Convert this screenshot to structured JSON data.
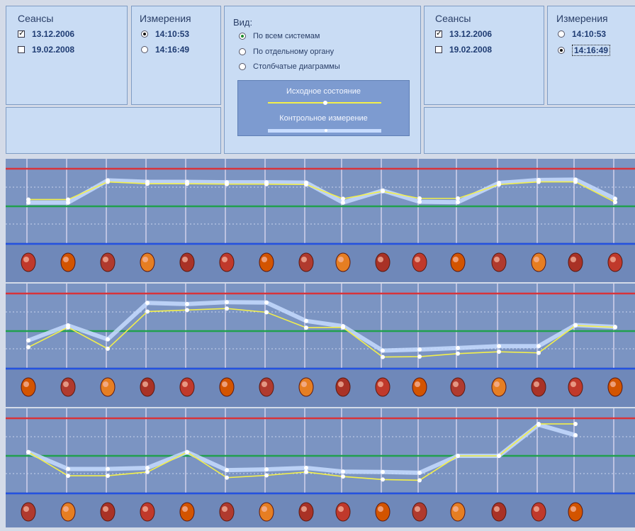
{
  "left": {
    "sessions": {
      "title": "Сеансы",
      "items": [
        {
          "label": "13.12.2006",
          "checked": true
        },
        {
          "label": "19.02.2008",
          "checked": false
        }
      ]
    },
    "measurements": {
      "title": "Измерения",
      "items": [
        {
          "label": "14:10:53",
          "selected": true
        },
        {
          "label": "14:16:49",
          "selected": false
        }
      ]
    }
  },
  "view": {
    "title": "Вид:",
    "options": [
      {
        "label": "По всем системам",
        "selected": true
      },
      {
        "label": "По отдельному органу",
        "selected": false
      },
      {
        "label": "Столбчатые диаграммы",
        "selected": false
      }
    ],
    "legend": {
      "baseline_label": "Исходное состояние",
      "baseline_color": "#f4f04a",
      "control_label": "Контрольное измерение",
      "control_color": "#c7dcff"
    }
  },
  "right": {
    "sessions": {
      "title": "Сеансы",
      "items": [
        {
          "label": "13.12.2006",
          "checked": true
        },
        {
          "label": "19.02.2008",
          "checked": false
        }
      ]
    },
    "measurements": {
      "title": "Измерения",
      "items": [
        {
          "label": "14:10:53",
          "selected": false
        },
        {
          "label": "14:16:49",
          "selected": true
        }
      ]
    }
  },
  "colors": {
    "upper_limit": "#d8343a",
    "norm": "#21a04e",
    "lower_limit": "#2452e0",
    "plot_background": "#7b94c2"
  },
  "chart_data": [
    {
      "type": "line",
      "x": [
        1,
        2,
        3,
        4,
        5,
        6,
        7,
        8,
        9,
        10,
        11,
        12,
        13,
        14,
        15,
        16
      ],
      "series": [
        {
          "values": [
            0.18,
            0.18,
            0.65,
            0.6,
            0.6,
            0.59,
            0.59,
            0.58,
            0.2,
            0.4,
            0.21,
            0.21,
            0.58,
            0.65,
            0.65,
            0.11
          ]
        },
        {
          "values": [
            0.1,
            0.1,
            0.69,
            0.65,
            0.65,
            0.64,
            0.64,
            0.63,
            0.1,
            0.42,
            0.12,
            0.11,
            0.62,
            0.7,
            0.71,
            0.2
          ]
        }
      ],
      "organ_icons": [
        "brain-icon",
        "brain-icon",
        "heart-vessels-icon",
        "heart-vessels-icon",
        "bronchi-icon",
        "bronchi-icon",
        "lungs-icon",
        "lungs-icon",
        "throat-icon",
        "liver-icon",
        "gallbladder-icon",
        "stomach-icon",
        "pancreas-icon",
        "colon-icon",
        "intestine-icon",
        "colon-icon"
      ]
    },
    {
      "type": "line",
      "x": [
        1,
        2,
        3,
        4,
        5,
        6,
        7,
        8,
        9,
        10,
        11,
        12,
        13,
        14,
        15,
        16
      ],
      "series": [
        {
          "values": [
            -0.43,
            0.1,
            -0.47,
            0.52,
            0.56,
            0.6,
            0.5,
            0.09,
            0.1,
            -0.69,
            -0.68,
            -0.6,
            -0.55,
            -0.58,
            0.15,
            0.1
          ]
        },
        {
          "values": [
            -0.25,
            0.15,
            -0.22,
            0.75,
            0.72,
            0.77,
            0.76,
            0.27,
            0.13,
            -0.52,
            -0.49,
            -0.45,
            -0.4,
            -0.4,
            0.16,
            0.11
          ]
        }
      ],
      "organ_icons": [
        "colon-icon",
        "pancreas-icon",
        "vessel-icon",
        "uterus-icon",
        "bladder-icon",
        "kidney-gland-icon",
        "kidney-gland-icon",
        "kidney-icon",
        "kidney-icon",
        "brain-section-icon",
        "brain-section-icon",
        "thyroid-icon",
        "thyroid-icon",
        "pelvis-icon",
        "organ-icon",
        "organ-icon"
      ]
    },
    {
      "type": "line",
      "x": [
        1,
        2,
        3,
        4,
        5,
        6,
        7,
        8,
        9,
        10,
        11,
        12,
        13,
        14,
        15,
        16
      ],
      "series": [
        {
          "values": [
            0.1,
            -0.53,
            -0.53,
            -0.43,
            0.1,
            -0.58,
            -0.52,
            -0.43,
            -0.55,
            -0.63,
            -0.65,
            0.0,
            0.0,
            0.85,
            0.85
          ]
        },
        {
          "values": [
            0.1,
            -0.35,
            -0.35,
            -0.32,
            0.1,
            -0.38,
            -0.36,
            -0.32,
            -0.42,
            -0.43,
            -0.45,
            0.0,
            0.0,
            0.83,
            0.55
          ]
        }
      ],
      "organ_icons": [
        "spine-icon",
        "spine-icon",
        "cochlea-icon",
        "cochlea-icon",
        "ear-icon",
        "eye-icon",
        "eye-icon",
        "ear-canal-icon",
        "ear-canal-icon",
        "sinus-icon",
        "sinus-icon",
        "foot-icon",
        "foot-icon",
        "knee-joint-icon",
        "knee-joint-icon"
      ]
    }
  ]
}
